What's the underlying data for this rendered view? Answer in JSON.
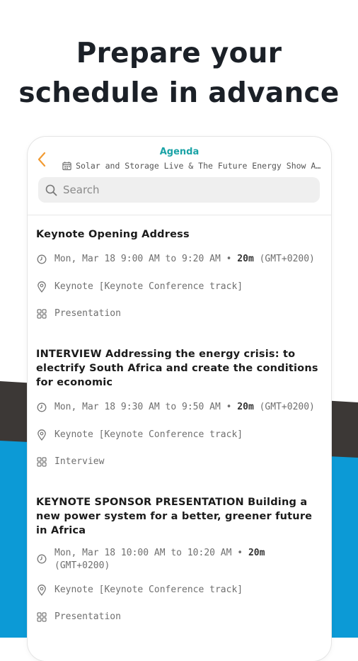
{
  "headline": {
    "line1": "Prepare your",
    "line2": "schedule in advance"
  },
  "topbar": {
    "title": "Agenda",
    "event_name": "Solar and Storage Live & The Future Energy Show Afr...",
    "back_icon": "chevron-left-icon",
    "calendar_icon": "calendar-icon"
  },
  "search": {
    "placeholder": "Search",
    "value": ""
  },
  "colors": {
    "accent_back": "#f29b32",
    "title_teal": "#1aa3a6",
    "band_dark": "#3c3836",
    "band_blue": "#0c9ad6"
  },
  "sessions": [
    {
      "title": "Keynote Opening Address",
      "time_range": "Mon, Mar 18 9:00 AM to 9:20 AM",
      "bullet": "•",
      "duration": "20m",
      "timezone": "(GMT+0200)",
      "location": "Keynote [Keynote Conference track]",
      "type": "Presentation"
    },
    {
      "title": "INTERVIEW Addressing the energy crisis: to electrify South Africa and create the conditions for economic",
      "time_range": "Mon, Mar 18 9:30 AM to 9:50 AM",
      "bullet": "•",
      "duration": "20m",
      "timezone": "(GMT+0200)",
      "location": "Keynote [Keynote Conference track]",
      "type": "Interview"
    },
    {
      "title": "KEYNOTE SPONSOR PRESENTATION Building a new power system for a better, greener future in Africa",
      "time_range": "Mon, Mar 18 10:00 AM to 10:20 AM",
      "bullet": "•",
      "duration": "20m",
      "timezone": "(GMT+0200)",
      "location": "Keynote [Keynote Conference track]",
      "type": "Presentation"
    }
  ]
}
